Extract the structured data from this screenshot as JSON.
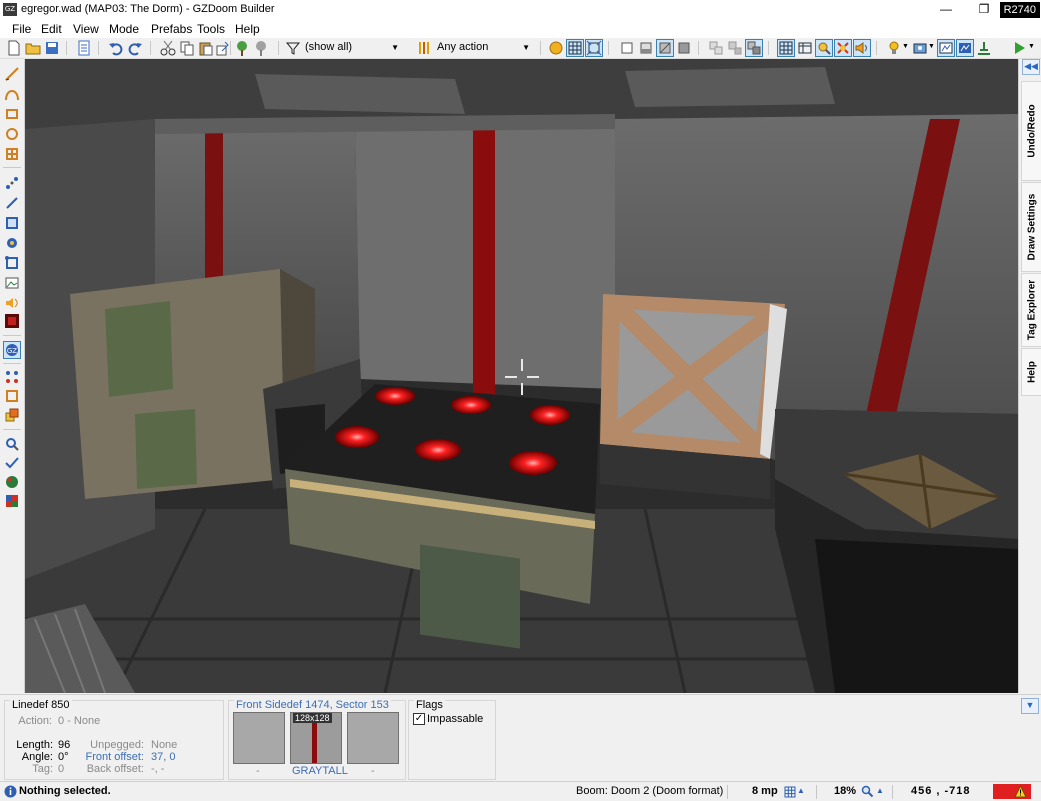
{
  "titlebar": {
    "app_icon_text": "GZ",
    "title": "egregor.wad (MAP03: The Dorm) - GZDoom Builder",
    "minimize_glyph": "—",
    "restore_glyph": "❐",
    "revision": "R2740"
  },
  "menu": [
    "File",
    "Edit",
    "View",
    "Mode",
    "Prefabs",
    "Tools",
    "Help"
  ],
  "toolbar": {
    "filter_combo": "(show all)",
    "action_combo": "Any action"
  },
  "viewport": {
    "crosshair": "visual-mode-crosshair"
  },
  "dockers": [
    "Undo/Redo",
    "Draw Settings",
    "Tag Explorer",
    "Help"
  ],
  "info": {
    "linedef_title": "Linedef 850",
    "action_label": "Action:",
    "action_value": "0 - None",
    "length_label": "Length:",
    "length_value": "96",
    "angle_label": "Angle:",
    "angle_value": "0°",
    "tag_label": "Tag:",
    "tag_value": "0",
    "unpegged_label": "Unpegged:",
    "unpegged_value": "None",
    "front_offset_label": "Front offset:",
    "front_offset_value": "37, 0",
    "back_offset_label": "Back offset:",
    "back_offset_value": "-, -",
    "sidedef_title": "Front Sidedef 1474, Sector 153",
    "upper_texture_name": "-",
    "middle_texture_name": "GRAYTALL",
    "middle_texture_size": "128x128",
    "lower_texture_name": "-",
    "flags_title": "Flags",
    "flag_impassable": "Impassable",
    "flag_check": "✓"
  },
  "status": {
    "message": "Nothing selected.",
    "map_format": "Boom: Doom 2 (Doom format)",
    "grid_size": "8 mp",
    "zoom": "18%",
    "coords": "456 , -718"
  },
  "colors": {
    "accent_blue": "#3c7fb1",
    "warning_red": "#e02020"
  }
}
